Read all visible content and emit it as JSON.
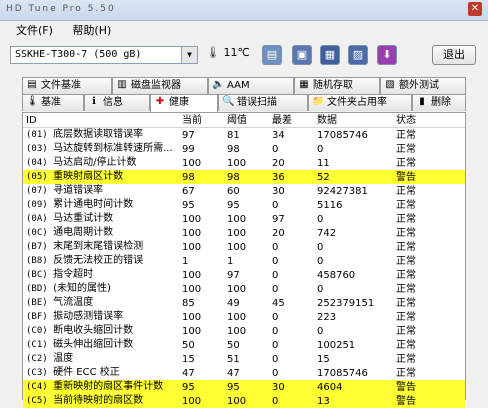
{
  "window": {
    "title": "HD Tune Pro 5.50",
    "close_glyph": "✕"
  },
  "menu": {
    "file": "文件",
    "help": "帮助"
  },
  "toolbar": {
    "drive": "SSKHE-T300-7 (500 gB)",
    "temperature": "11℃",
    "exit_label": "退出",
    "buttons": [
      {
        "name": "copy-text-button",
        "glyph": "▤",
        "color": "#6f8fbf"
      },
      {
        "name": "copy-screenshot-button",
        "glyph": "▣",
        "color": "#5a78b0"
      },
      {
        "name": "save-button",
        "glyph": "▦",
        "color": "#3f5f9f"
      },
      {
        "name": "options-button",
        "glyph": "▨",
        "color": "#4a6aa8"
      },
      {
        "name": "download-button",
        "glyph": "⬇",
        "color": "#9a3fb0"
      }
    ]
  },
  "tabs_row1": [
    "文件基准",
    "磁盘监视器",
    "AAM",
    "随机存取",
    "额外测试"
  ],
  "tabs_row2": [
    "基准",
    "信息",
    "健康",
    "错误扫描",
    "文件夹占用率",
    "删除"
  ],
  "table": {
    "headers": [
      "ID",
      "当前",
      "阈值",
      "最差",
      "数据",
      "状态"
    ],
    "rows": [
      {
        "id": "(01)",
        "name": "底层数据读取错误率",
        "cur": "97",
        "thr": "81",
        "worst": "34",
        "data": "17085746",
        "status": "正常",
        "warn": false
      },
      {
        "id": "(03)",
        "name": "马达旋转到标准转速所需...",
        "cur": "99",
        "thr": "98",
        "worst": "0",
        "data": "0",
        "status": "正常",
        "warn": false
      },
      {
        "id": "(04)",
        "name": "马达启动/停止计数",
        "cur": "100",
        "thr": "100",
        "worst": "20",
        "data": "11",
        "status": "正常",
        "warn": false
      },
      {
        "id": "(05)",
        "name": "重映射扇区计数",
        "cur": "98",
        "thr": "98",
        "worst": "36",
        "data": "52",
        "status": "警告",
        "warn": true
      },
      {
        "id": "(07)",
        "name": "寻道错误率",
        "cur": "67",
        "thr": "60",
        "worst": "30",
        "data": "92427381",
        "status": "正常",
        "warn": false
      },
      {
        "id": "(09)",
        "name": "累计通电时间计数",
        "cur": "95",
        "thr": "95",
        "worst": "0",
        "data": "5116",
        "status": "正常",
        "warn": false
      },
      {
        "id": "(0A)",
        "name": "马达重试计数",
        "cur": "100",
        "thr": "100",
        "worst": "97",
        "data": "0",
        "status": "正常",
        "warn": false
      },
      {
        "id": "(0C)",
        "name": "通电周期计数",
        "cur": "100",
        "thr": "100",
        "worst": "20",
        "data": "742",
        "status": "正常",
        "warn": false
      },
      {
        "id": "(B7)",
        "name": "末尾到末尾错误检测",
        "cur": "100",
        "thr": "100",
        "worst": "0",
        "data": "0",
        "status": "正常",
        "warn": false
      },
      {
        "id": "(B8)",
        "name": "反馈无法校正的错误",
        "cur": "1",
        "thr": "1",
        "worst": "0",
        "data": "0",
        "status": "正常",
        "warn": false
      },
      {
        "id": "(BC)",
        "name": "指令超时",
        "cur": "100",
        "thr": "97",
        "worst": "0",
        "data": "458760",
        "status": "正常",
        "warn": false
      },
      {
        "id": "(BD)",
        "name": "(未知的属性)",
        "cur": "100",
        "thr": "100",
        "worst": "0",
        "data": "0",
        "status": "正常",
        "warn": false
      },
      {
        "id": "(BE)",
        "name": "气流温度",
        "cur": "85",
        "thr": "49",
        "worst": "45",
        "data": "252379151",
        "status": "正常",
        "warn": false
      },
      {
        "id": "(BF)",
        "name": "振动感测错误率",
        "cur": "100",
        "thr": "100",
        "worst": "0",
        "data": "223",
        "status": "正常",
        "warn": false
      },
      {
        "id": "(C0)",
        "name": "断电收头缩回计数",
        "cur": "100",
        "thr": "100",
        "worst": "0",
        "data": "0",
        "status": "正常",
        "warn": false
      },
      {
        "id": "(C1)",
        "name": "磁头伸出缩回计数",
        "cur": "50",
        "thr": "50",
        "worst": "0",
        "data": "100251",
        "status": "正常",
        "warn": false
      },
      {
        "id": "(C2)",
        "name": "温度",
        "cur": "15",
        "thr": "51",
        "worst": "0",
        "data": "15",
        "status": "正常",
        "warn": false
      },
      {
        "id": "(C3)",
        "name": "硬件 ECC 校正",
        "cur": "47",
        "thr": "47",
        "worst": "0",
        "data": "17085746",
        "status": "正常",
        "warn": false
      },
      {
        "id": "(C4)",
        "name": "重新映射的扇区事件计数",
        "cur": "95",
        "thr": "95",
        "worst": "30",
        "data": "4604",
        "status": "警告",
        "warn": true
      },
      {
        "id": "(C5)",
        "name": "当前待映射的扇区数",
        "cur": "100",
        "thr": "100",
        "worst": "0",
        "data": "13",
        "status": "警告",
        "warn": true
      }
    ]
  }
}
